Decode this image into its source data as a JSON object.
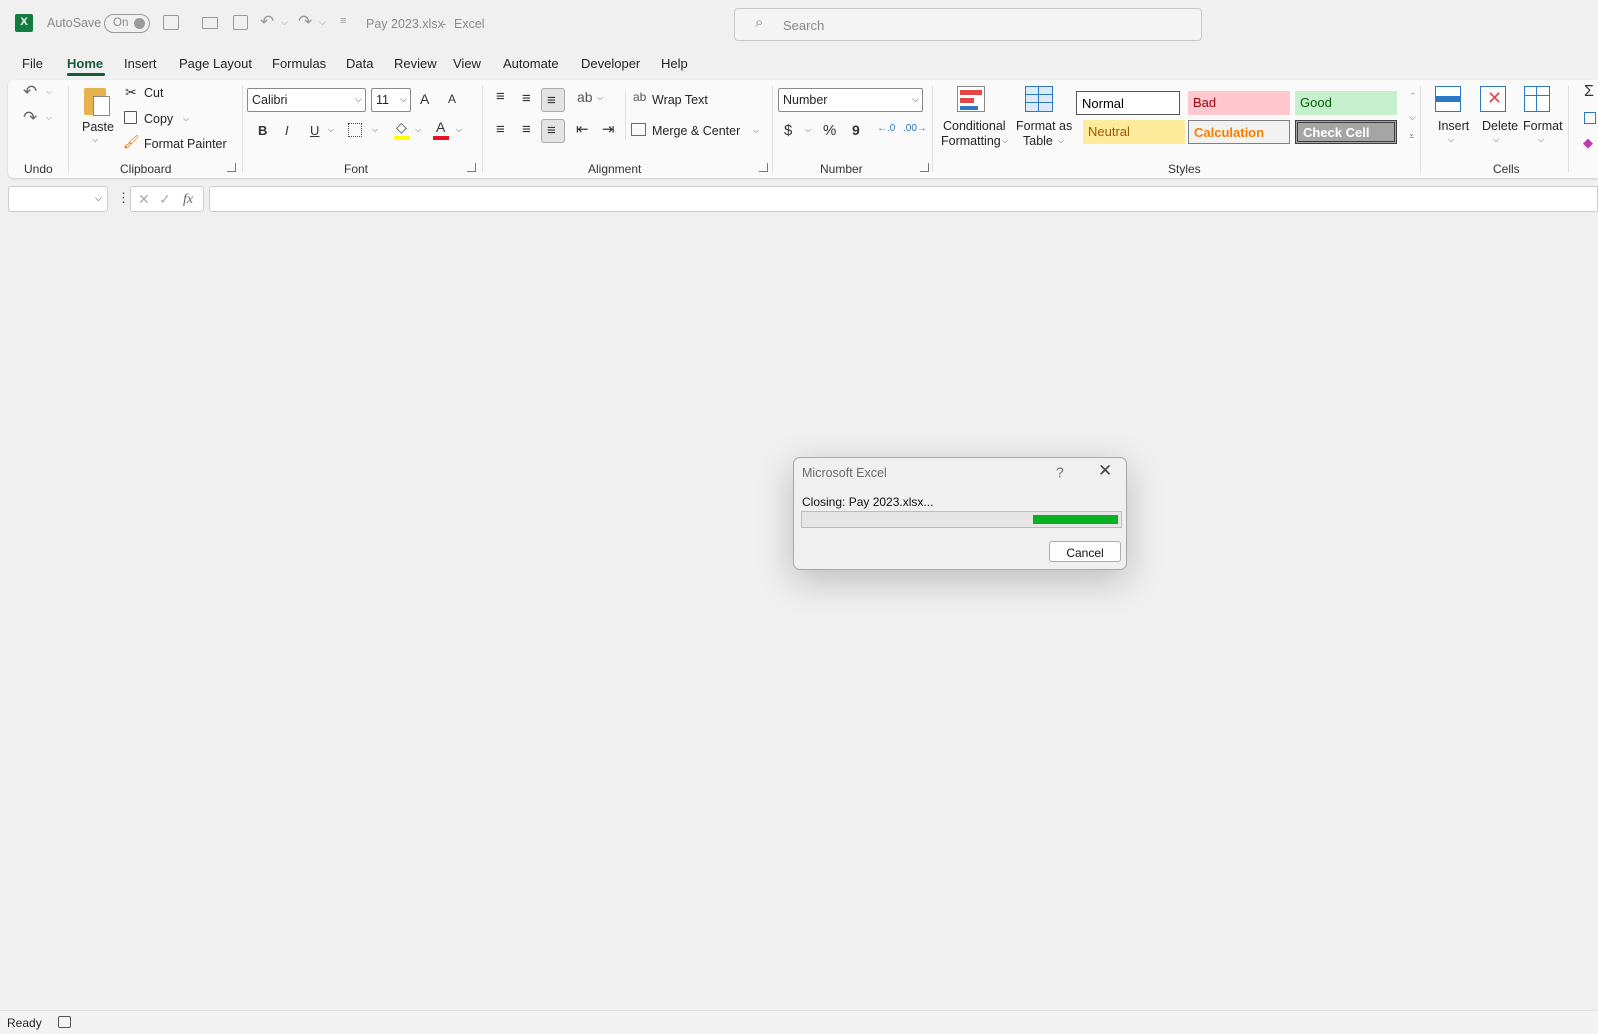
{
  "titlebar": {
    "autosave_label": "AutoSave",
    "autosave_state": "On",
    "doc_title": "Pay 2023.xlsx",
    "separator": "-",
    "app_name": "Excel",
    "search_placeholder": "Search"
  },
  "tabs": [
    "File",
    "Home",
    "Insert",
    "Page Layout",
    "Formulas",
    "Data",
    "Review",
    "View",
    "Automate",
    "Developer",
    "Help"
  ],
  "active_tab": "Home",
  "ribbon": {
    "undo_group": "Undo",
    "clipboard": {
      "group": "Clipboard",
      "paste": "Paste",
      "cut": "Cut",
      "copy": "Copy",
      "format_painter": "Format Painter"
    },
    "font": {
      "group": "Font",
      "name": "Calibri",
      "size": "11",
      "bold": "B",
      "italic": "I",
      "underline": "U",
      "grow": "A",
      "shrink": "A",
      "color": "A"
    },
    "alignment": {
      "group": "Alignment",
      "wrap_text": "Wrap Text",
      "merge_center": "Merge & Center"
    },
    "number": {
      "group": "Number",
      "format": "Number",
      "currency": "$",
      "percent": "%",
      "comma": "9"
    },
    "styles": {
      "group": "Styles",
      "conditional_formatting": [
        "Conditional",
        "Formatting"
      ],
      "format_as_table": [
        "Format as",
        "Table"
      ],
      "gallery": [
        {
          "label": "Normal",
          "bg": "#ffffff",
          "fg": "#000000"
        },
        {
          "label": "Bad",
          "bg": "#ffc7ce",
          "fg": "#9c0006"
        },
        {
          "label": "Good",
          "bg": "#c6efce",
          "fg": "#006100"
        },
        {
          "label": "Neutral",
          "bg": "#ffeb9c",
          "fg": "#9c5700"
        },
        {
          "label": "Calculation",
          "bg": "#f2f2f2",
          "fg": "#fa7d00"
        },
        {
          "label": "Check Cell",
          "bg": "#a5a5a5",
          "fg": "#ffffff"
        }
      ]
    },
    "cells": {
      "group": "Cells",
      "insert": "Insert",
      "delete": "Delete",
      "format": "Format"
    },
    "editing": {
      "autosum": "Σ"
    }
  },
  "formula_bar": {
    "fx": "fx",
    "name_box": "",
    "content": ""
  },
  "status_bar": {
    "mode": "Ready"
  },
  "dialog": {
    "title": "Microsoft Excel",
    "help": "?",
    "message": "Closing: Pay 2023.xlsx...",
    "progress_fraction": 0.27,
    "cancel_label": "Cancel",
    "progress_color": "#06b025"
  },
  "colors": {
    "accent": "#185c37",
    "excel_icon": "#107c41",
    "font_color_bar": "#e81123",
    "highlight_bar": "#ffff00"
  }
}
